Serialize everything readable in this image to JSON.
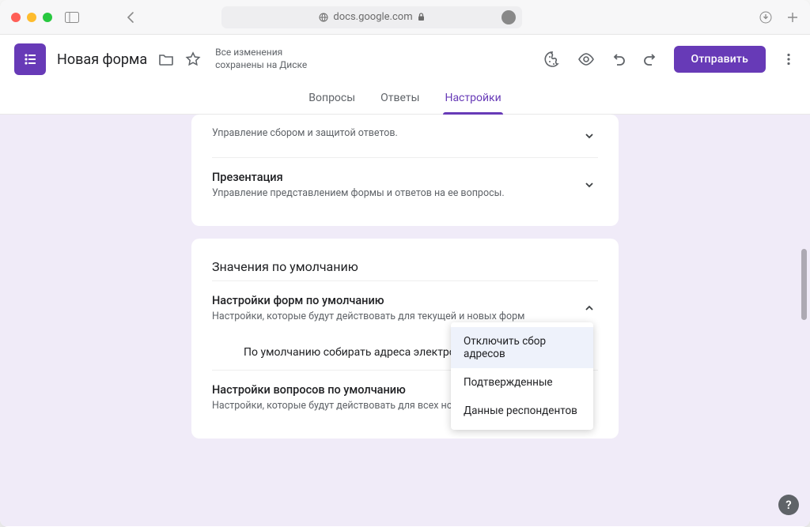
{
  "browser": {
    "url_host": "docs.google.com"
  },
  "header": {
    "form_title": "Новая форма",
    "save_status": "Все изменения сохранены на Диске",
    "send_label": "Отправить"
  },
  "tabs": {
    "questions": "Вопросы",
    "responses": "Ответы",
    "settings": "Настройки"
  },
  "card_responses": {
    "collect_desc": "Управление сбором и защитой ответов.",
    "presentation_title": "Презентация",
    "presentation_desc": "Управление представлением формы и ответов на ее вопросы."
  },
  "defaults": {
    "card_title": "Значения по умолчанию",
    "form_defaults_title": "Настройки форм по умолчанию",
    "form_defaults_desc": "Настройки, которые будут действовать для текущей и новых форм",
    "collect_email_label": "По умолчанию собирать адреса электронной почты",
    "question_defaults_title": "Настройки вопросов по умолчанию",
    "question_defaults_desc": "Настройки, которые будут действовать для всех новых вопросов"
  },
  "dropdown": {
    "opt_off": "Отключить сбор адресов",
    "opt_verified": "Подтвержденные",
    "opt_responder": "Данные респондентов"
  }
}
